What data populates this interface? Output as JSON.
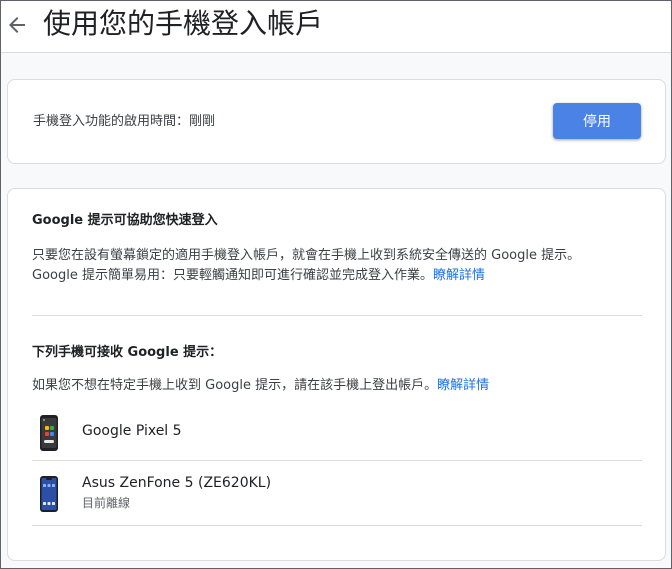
{
  "header": {
    "title": "使用您的手機登入帳戶",
    "back_icon": "arrow-back-icon"
  },
  "status_card": {
    "text": "手機登入功能的啟用時間：剛剛",
    "disable_button": "停用",
    "button_color": "#4b82e6"
  },
  "prompt_card": {
    "title": "Google 提示可協助您快速登入",
    "line1": "只要您在設有螢幕鎖定的適用手機登入帳戶，就會在手機上收到系統安全傳送的 Google 提示。",
    "line2_text": "Google 提示簡單易用：只要輕觸通知即可進行確認並完成登入作業。",
    "line2_link": "瞭解詳情",
    "devices_title": "下列手機可接收 Google 提示：",
    "devices_desc": "如果您不想在特定手機上收到 Google 提示，請在該手機上登出帳戶。",
    "devices_link": "瞭解詳情",
    "link_color": "#1a73e8"
  },
  "devices": [
    {
      "name": "Google Pixel 5",
      "status": "",
      "icon": "pixel-phone-icon"
    },
    {
      "name": "Asus ZenFone 5 (ZE620KL)",
      "status": "目前離線",
      "icon": "zenfone-phone-icon"
    }
  ]
}
